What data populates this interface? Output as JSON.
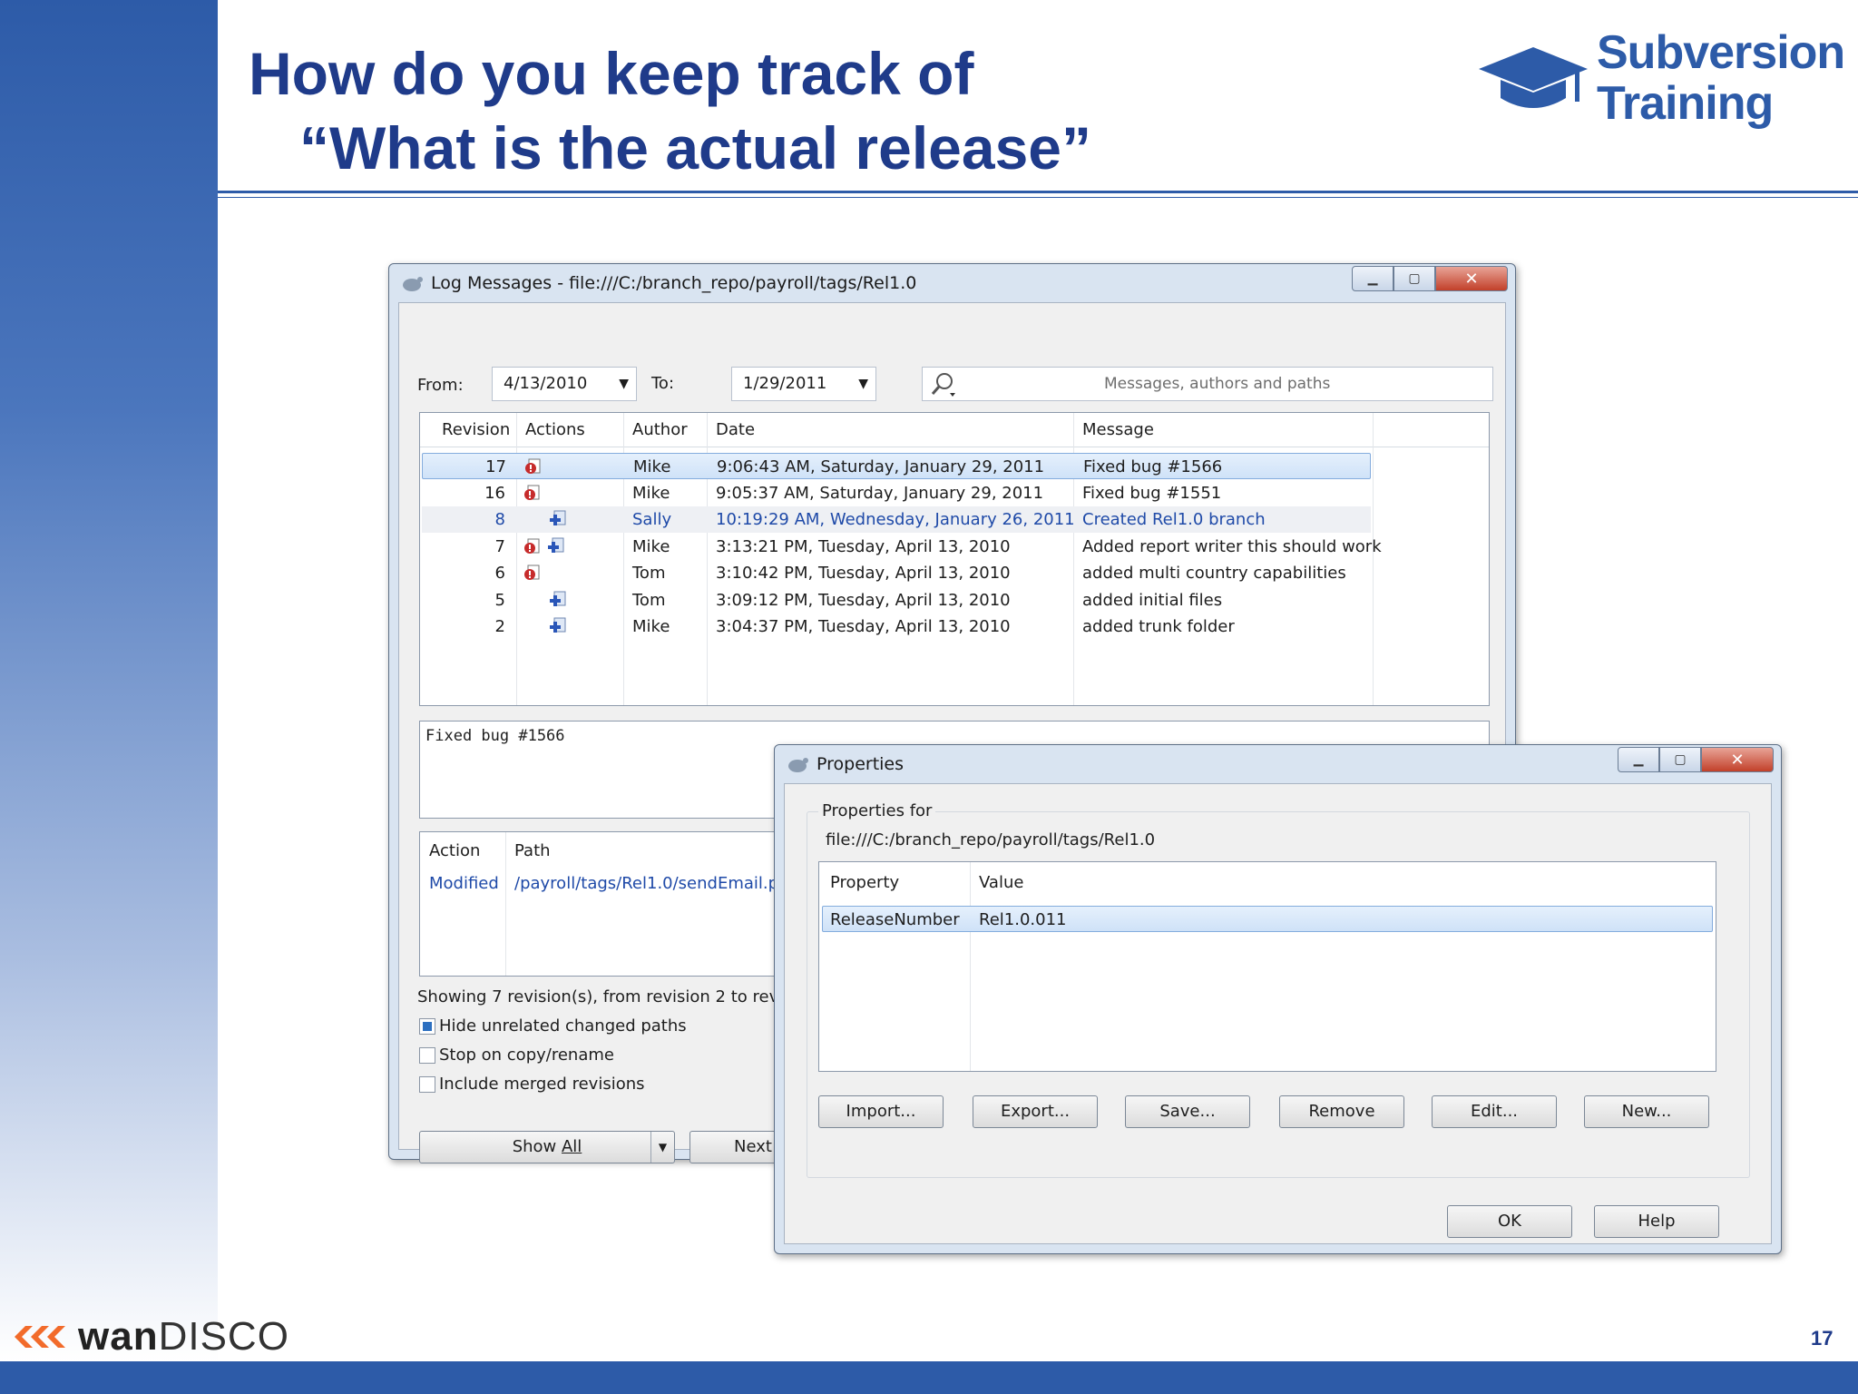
{
  "slide": {
    "title_line1": "How do you keep track of",
    "title_line2": "“What is the actual release”",
    "logo_line1": "Subversion",
    "logo_line2": "Training",
    "company_brand_bold": "wan",
    "company_brand_light": "DISCO",
    "page_number": "17"
  },
  "log_window": {
    "title": "Log Messages - file:///C:/branch_repo/payroll/tags/Rel1.0",
    "from_label": "From:",
    "from_value": "4/13/2010",
    "to_label": "To:",
    "to_value": "1/29/2011",
    "search_placeholder": "Messages, authors and paths",
    "columns": [
      "Revision",
      "Actions",
      "Author",
      "Date",
      "Message"
    ],
    "rows": [
      {
        "revision": "17",
        "actions": [
          "modified"
        ],
        "author": "Mike",
        "date": "9:06:43 AM, Saturday, January 29, 2011",
        "message": "Fixed bug #1566"
      },
      {
        "revision": "16",
        "actions": [
          "modified"
        ],
        "author": "Mike",
        "date": "9:05:37 AM, Saturday, January 29, 2011",
        "message": "Fixed bug #1551"
      },
      {
        "revision": "8",
        "actions": [
          "added"
        ],
        "author": "Sally",
        "date": "10:19:29 AM, Wednesday, January 26, 2011",
        "message": "Created Rel1.0 branch"
      },
      {
        "revision": "7",
        "actions": [
          "modified",
          "added"
        ],
        "author": "Mike",
        "date": "3:13:21 PM, Tuesday, April 13, 2010",
        "message": "Added report writer this should work"
      },
      {
        "revision": "6",
        "actions": [
          "modified"
        ],
        "author": "Tom",
        "date": "3:10:42 PM, Tuesday, April 13, 2010",
        "message": "added multi country capabilities"
      },
      {
        "revision": "5",
        "actions": [
          "added"
        ],
        "author": "Tom",
        "date": "3:09:12 PM, Tuesday, April 13, 2010",
        "message": "added initial files"
      },
      {
        "revision": "2",
        "actions": [
          "added"
        ],
        "author": "Mike",
        "date": "3:04:37 PM, Tuesday, April 13, 2010",
        "message": "added trunk folder"
      }
    ],
    "selected_message": "Fixed bug #1566",
    "paths_columns": [
      "Action",
      "Path"
    ],
    "paths_rows": [
      {
        "action": "Modified",
        "path": "/payroll/tags/Rel1.0/sendEmail.php"
      }
    ],
    "status_text": "Showing 7 revision(s), from revision 2 to revision 17",
    "checkboxes": [
      {
        "label": "Hide unrelated changed paths",
        "checked": true
      },
      {
        "label": "Stop on copy/rename",
        "checked": false
      },
      {
        "label": "Include merged revisions",
        "checked": false
      }
    ],
    "show_all_pre": "Show ",
    "show_all_ul": "All",
    "next_label": "Next 100"
  },
  "properties_window": {
    "title": "Properties",
    "group_label": "Properties for",
    "path": "file:///C:/branch_repo/payroll/tags/Rel1.0",
    "columns": [
      "Property",
      "Value"
    ],
    "rows": [
      {
        "property": "ReleaseNumber",
        "value": "Rel1.0.011"
      }
    ],
    "buttons": [
      "Import...",
      "Export...",
      "Save...",
      "Remove",
      "Edit...",
      "New..."
    ],
    "ok_label": "OK",
    "help_label": "Help"
  }
}
